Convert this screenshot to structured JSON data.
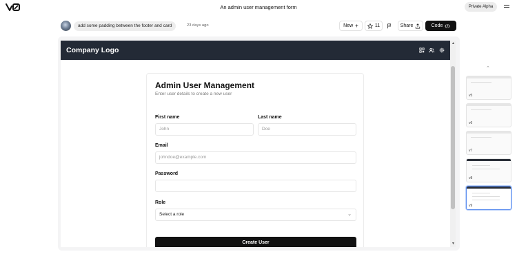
{
  "app": {
    "logo_text": "v0",
    "page_title": "An admin user management form",
    "badge": "Private Alpha",
    "menu_icon": "hamburger-icon"
  },
  "message": {
    "prompt": "add some padding between the footer and card",
    "time": "23 days ago"
  },
  "toolbar": {
    "new_label": "New",
    "new_icon": "plus-icon",
    "star_count": "11",
    "star_icon": "star-icon",
    "flag_icon": "flag-icon",
    "share_label": "Share",
    "share_icon": "share-icon",
    "code_label": "Code",
    "code_icon": "code-icon"
  },
  "preview": {
    "header": {
      "brand": "Company Logo",
      "icons": [
        "qr-icon",
        "users-icon",
        "gear-icon"
      ],
      "bg": "#232a36"
    },
    "form": {
      "title": "Admin User Management",
      "subtitle": "Enter user details to create a new user",
      "first_name_label": "First name",
      "first_name_placeholder": "John",
      "last_name_label": "Last name",
      "last_name_placeholder": "Doe",
      "email_label": "Email",
      "email_placeholder": "johndoe@example.com",
      "password_label": "Password",
      "password_placeholder": "",
      "role_label": "Role",
      "role_placeholder": "Select a role",
      "submit_label": "Create User"
    }
  },
  "versions": [
    {
      "label": "v5",
      "style": "light"
    },
    {
      "label": "v6",
      "style": "light"
    },
    {
      "label": "v7",
      "style": "light"
    },
    {
      "label": "v8",
      "style": "dark"
    },
    {
      "label": "v9",
      "style": "dark",
      "active": true
    }
  ]
}
